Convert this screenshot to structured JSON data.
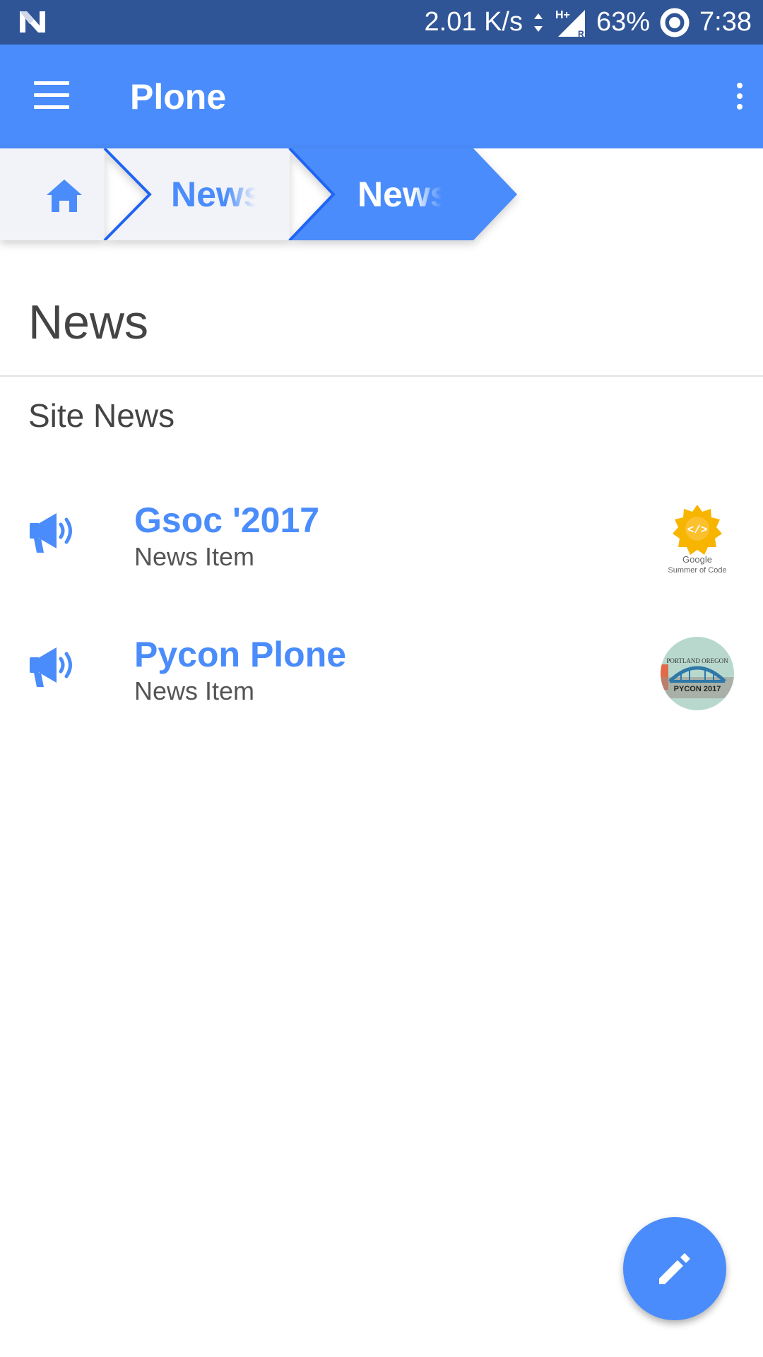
{
  "status_bar": {
    "net_speed": "2.01 K/s",
    "battery": "63%",
    "time": "7:38",
    "icons": [
      "notification-n-icon",
      "data-arrows-icon",
      "signal-h-plus-icon",
      "battery-icon"
    ]
  },
  "app_bar": {
    "title": "Plone",
    "icons": [
      "menu-icon",
      "more-vert-icon"
    ],
    "color": "#4a8cfb"
  },
  "breadcrumb": {
    "items": [
      {
        "label": "",
        "icon": "home-icon",
        "active": false
      },
      {
        "label": "News",
        "active": false
      },
      {
        "label": "News",
        "active": true
      }
    ]
  },
  "page": {
    "title": "News",
    "section_title": "Site News"
  },
  "news_items": [
    {
      "title": "Gsoc '2017",
      "subtitle": "News Item",
      "icon": "megaphone-icon",
      "thumbnail": "gsoc-logo",
      "thumb_text_1": "Google",
      "thumb_text_2": "Summer of Code"
    },
    {
      "title": "Pycon Plone",
      "subtitle": "News Item",
      "icon": "megaphone-icon",
      "thumbnail": "pycon-logo",
      "thumb_text_1": "PORTLAND OREGON",
      "thumb_text_2": "PYCON 2017"
    }
  ],
  "fab": {
    "icon": "edit-pencil-icon"
  },
  "colors": {
    "status_bar": "#2f5596",
    "primary": "#4a8cfb",
    "breadcrumb_inactive": "#f1f3f8",
    "breadcrumb_edge": "#1f64f2"
  }
}
